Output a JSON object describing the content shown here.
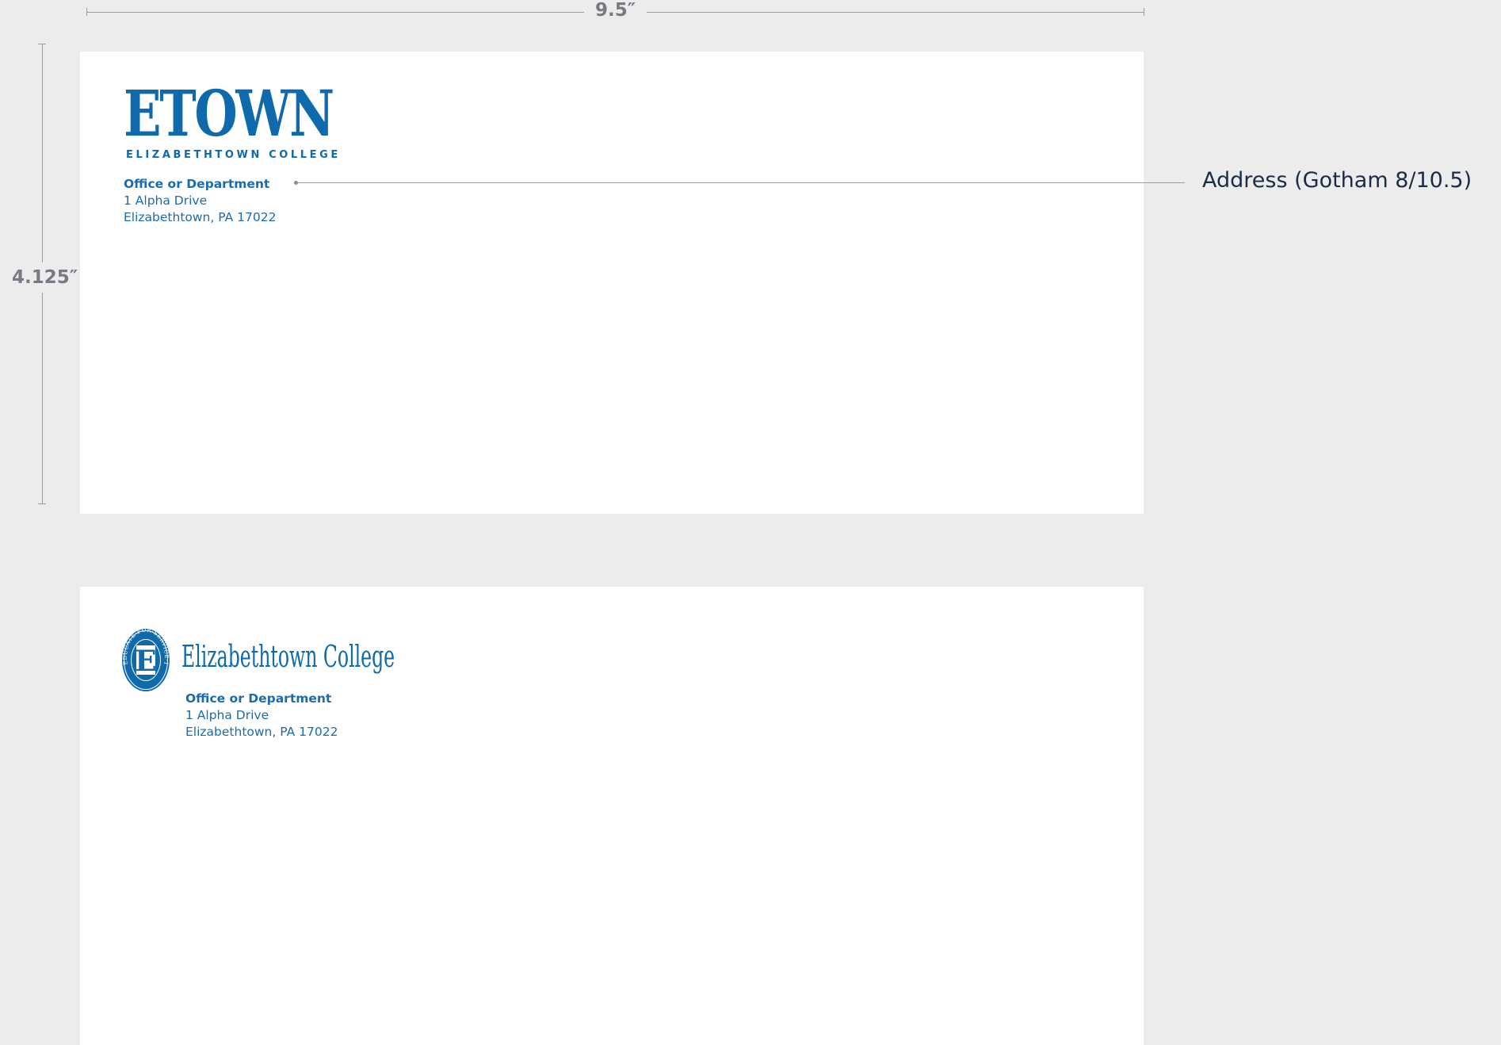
{
  "dimensions": {
    "width_label": "9.5″",
    "height_label": "4.125″"
  },
  "envelope_1": {
    "logo_word": "ETOWN",
    "logo_sub": "ELIZABETHTOWN COLLEGE",
    "address": {
      "department": "Office or Department",
      "line1": "1 Alpha Drive",
      "line2": "Elizabethtown, PA 17022"
    }
  },
  "callout": {
    "label": "Address (Gotham 8/10.5)"
  },
  "envelope_2": {
    "seal_text": "EDUCATE·FOR·SERVICE·1899",
    "seal_letter": "E",
    "logo_word": "Elizabethtown College",
    "address": {
      "department": "Office or Department",
      "line1": "1 Alpha Drive",
      "line2": "Elizabethtown, PA 17022"
    }
  },
  "colors": {
    "brand_blue": "#0e6aab",
    "background": "#ececec",
    "dimension_gray": "#777a85"
  }
}
